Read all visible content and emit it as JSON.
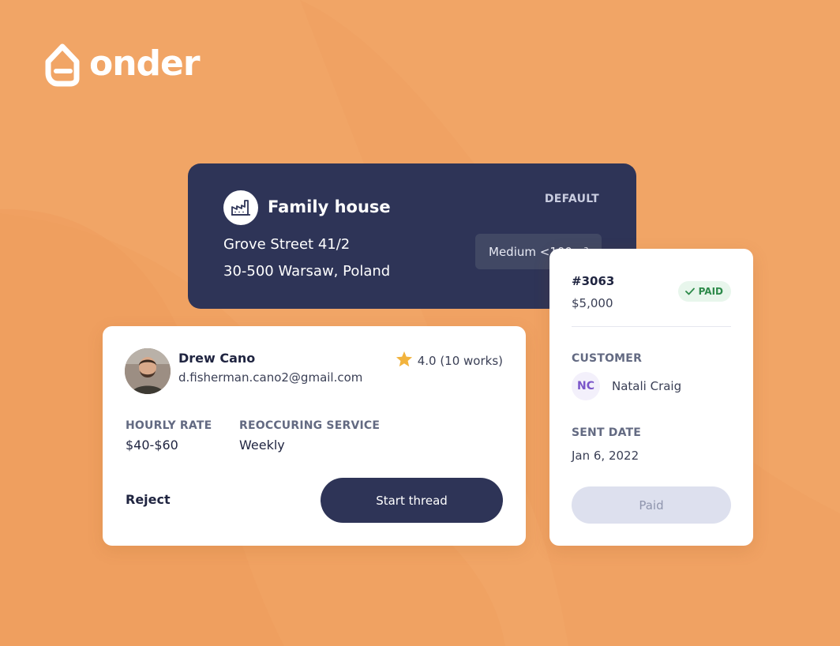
{
  "brand": {
    "name": "onder",
    "icon": "house-e-icon"
  },
  "property": {
    "icon": "factory-icon",
    "title": "Family house",
    "tag": "DEFAULT",
    "address_line1": "Grove Street 41/2",
    "address_line2": "30-500 Warsaw, Poland",
    "size_label": "Medium <100m²"
  },
  "contractor": {
    "name": "Drew Cano",
    "email": "d.fisherman.cano2@gmail.com",
    "rating": "4.0 (10 works)",
    "rating_icon": "star-icon",
    "hourly_rate_label": "HOURLY RATE",
    "hourly_rate": "$40-$60",
    "service_label": "REOCCURING SERVICE",
    "service": "Weekly",
    "reject_label": "Reject",
    "start_label": "Start thread"
  },
  "invoice": {
    "number": "#3063",
    "amount": "$5,000",
    "status": "PAID",
    "customer_label": "CUSTOMER",
    "customer_initials": "NC",
    "customer_name": "Natali Craig",
    "sent_label": "SENT DATE",
    "sent_date": "Jan 6, 2022",
    "action_label": "Paid"
  },
  "colors": {
    "background": "#f0a262",
    "navy": "#2e3457",
    "paid_green": "#2d8a4a",
    "star": "#f2b33d"
  }
}
